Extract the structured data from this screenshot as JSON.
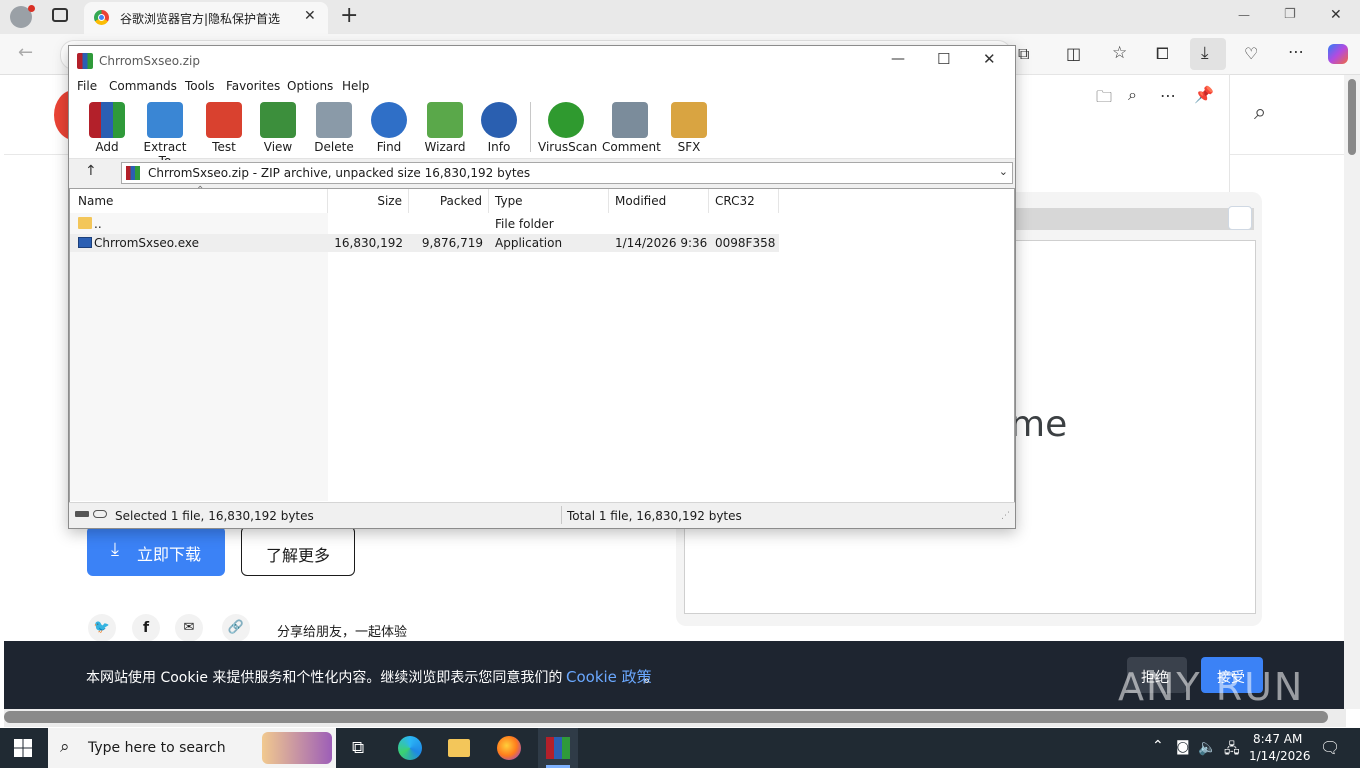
{
  "browser": {
    "tab_title": "谷歌浏览器官方|隐私保护首选",
    "new_tab_glyph": "+",
    "window_controls": [
      "—",
      "❐",
      "✕"
    ]
  },
  "webpage": {
    "download_button": "立即下载",
    "learn_more_button": "了解更多",
    "share_text": "分享给朋友，一起体验",
    "partial_heading": "me",
    "cookie_text": "本网站使用 Cookie 来提供服务和个性化内容。继续浏览即表示您同意我们的",
    "cookie_link": "Cookie 政策",
    "cookie_end": "。",
    "reject_button": "拒绝",
    "accept_button": "接受",
    "watermark": "ANY RUN"
  },
  "winrar": {
    "title": "ChrromSxseo.zip",
    "menu": [
      "File",
      "Commands",
      "Tools",
      "Favorites",
      "Options",
      "Help"
    ],
    "tools": [
      {
        "label": "Add",
        "icon": "add-icon",
        "color": "#c0392b"
      },
      {
        "label": "Extract To",
        "icon": "extract-to-icon",
        "color": "#3a86d4"
      },
      {
        "label": "Test",
        "icon": "test-icon",
        "color": "#d9412f"
      },
      {
        "label": "View",
        "icon": "view-icon",
        "color": "#3c8f3c"
      },
      {
        "label": "Delete",
        "icon": "delete-icon",
        "color": "#8a9aa8"
      },
      {
        "label": "Find",
        "icon": "find-icon",
        "color": "#2f6fc7"
      },
      {
        "label": "Wizard",
        "icon": "wizard-icon",
        "color": "#5aa84a"
      },
      {
        "label": "Info",
        "icon": "info-icon",
        "color": "#2a5fb0"
      },
      {
        "label": "VirusScan",
        "icon": "virusscan-icon",
        "color": "#2f9a2f"
      },
      {
        "label": "Comment",
        "icon": "comment-icon",
        "color": "#7b8c9b"
      },
      {
        "label": "SFX",
        "icon": "sfx-icon",
        "color": "#d9a441"
      }
    ],
    "path_text": "ChrromSxseo.zip - ZIP archive, unpacked size 16,830,192 bytes",
    "columns": [
      "Name",
      "Size",
      "Packed",
      "Type",
      "Modified",
      "CRC32"
    ],
    "rows": [
      {
        "name": "..",
        "size": "",
        "packed": "",
        "type": "File folder",
        "modified": "",
        "crc": ""
      },
      {
        "name": "ChrromSxseo.exe",
        "size": "16,830,192",
        "packed": "9,876,719",
        "type": "Application",
        "modified": "1/14/2026 9:36 ...",
        "crc": "0098F358"
      }
    ],
    "status_left": "Selected 1 file, 16,830,192 bytes",
    "status_right": "Total 1 file, 16,830,192 bytes"
  },
  "taskbar": {
    "search_placeholder": "Type here to search",
    "time": "8:47 AM",
    "date": "1/14/2026"
  }
}
